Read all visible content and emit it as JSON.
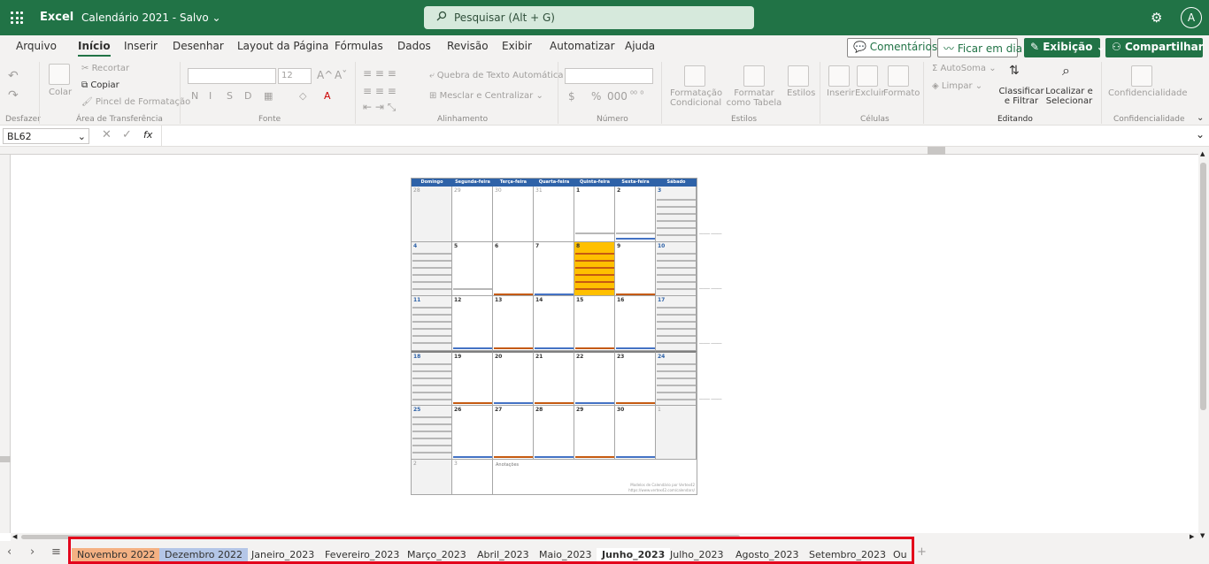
{
  "titlebar": {
    "app": "Excel",
    "document": "Calendário 2021 - Salvo",
    "chevron": "⌄",
    "search_placeholder": "Pesquisar (Alt + G)",
    "user_initial": "A",
    "settings_icon": "gear-icon"
  },
  "menu_tabs": [
    "Arquivo",
    "Início",
    "Inserir",
    "Desenhar",
    "Layout da Página",
    "Fórmulas",
    "Dados",
    "Revisão",
    "Exibir",
    "Automatizar",
    "Ajuda"
  ],
  "active_tab": "Início",
  "right_buttons": {
    "comments": "Comentários",
    "catch_up": "Ficar em dia",
    "view": "Exibição",
    "share": "Compartilhar"
  },
  "ribbon": {
    "undo_group": "Desfazer",
    "clipboard": {
      "paste": "Colar",
      "cut": "Recortar",
      "copy": "Copiar",
      "format_painter": "Pincel de Formatação",
      "label": "Área de Transferência"
    },
    "font": {
      "size": "12",
      "bold": "N",
      "italic": "I",
      "underline": "S",
      "strike": "D",
      "label": "Fonte",
      "grow": "A^",
      "shrink": "Aˇ"
    },
    "alignment": {
      "wrap": "Quebra de Texto Automática",
      "merge": "Mesclar e Centralizar",
      "label": "Alinhamento"
    },
    "number": {
      "currency": "$",
      "percent": "%",
      "thousands": "000",
      "label": "Número"
    },
    "styles": {
      "conditional": "Formatação Condicional",
      "table": "Formatar como Tabela",
      "styles": "Estilos",
      "label": "Estilos"
    },
    "cells": {
      "insert": "Inserir",
      "delete": "Excluir",
      "format": "Formato",
      "label": "Células"
    },
    "editing": {
      "autosum": "AutoSoma",
      "clear": "Limpar",
      "sort": "Classificar e Filtrar",
      "find": "Localizar e Selecionar",
      "label": "Editando"
    },
    "sensitivity": {
      "label": "Confidencialidade"
    }
  },
  "formula_bar": {
    "name_box": "BL62",
    "fx": "fx"
  },
  "calendar": {
    "headers": [
      "Domingo",
      "Segunda-feira",
      "Terça-feira",
      "Quarta-feira",
      "Quinta-feira",
      "Sexta-feira",
      "Sábado"
    ],
    "weeks": [
      [
        "28",
        "29",
        "30",
        "31",
        "1",
        "2",
        "3"
      ],
      [
        "4",
        "5",
        "6",
        "7",
        "8",
        "9",
        "10"
      ],
      [
        "11",
        "12",
        "13",
        "14",
        "15",
        "16",
        "17"
      ],
      [
        "18",
        "19",
        "20",
        "21",
        "22",
        "23",
        "24"
      ],
      [
        "25",
        "26",
        "27",
        "28",
        "29",
        "30",
        "1"
      ],
      [
        "2",
        "3",
        "",
        "",
        "",
        "",
        ""
      ]
    ],
    "notes_label": "Anotações",
    "footer": "Modelos de Calendário por Vertex42",
    "footer_url": "https://www.vertex42.com/calendars/"
  },
  "sheet_tabs": [
    "Novembro 2022",
    "Dezembro 2022",
    "Janeiro_2023",
    "Fevereiro_2023",
    "Março_2023",
    "Abril_2023",
    "Maio_2023",
    "Junho_2023",
    "Julho_2023",
    "Agosto_2023",
    "Setembro_2023",
    "Ou"
  ],
  "sheet_tab_colors": {
    "Novembro 2022": "#f4b183",
    "Dezembro 2022": "#b4c6e7"
  },
  "active_sheet": "Junho_2023",
  "colors": {
    "brand": "#217346",
    "calendar_header": "#2e62a8",
    "highlight": "#ffc000",
    "tab_outline": "#e3001b"
  }
}
